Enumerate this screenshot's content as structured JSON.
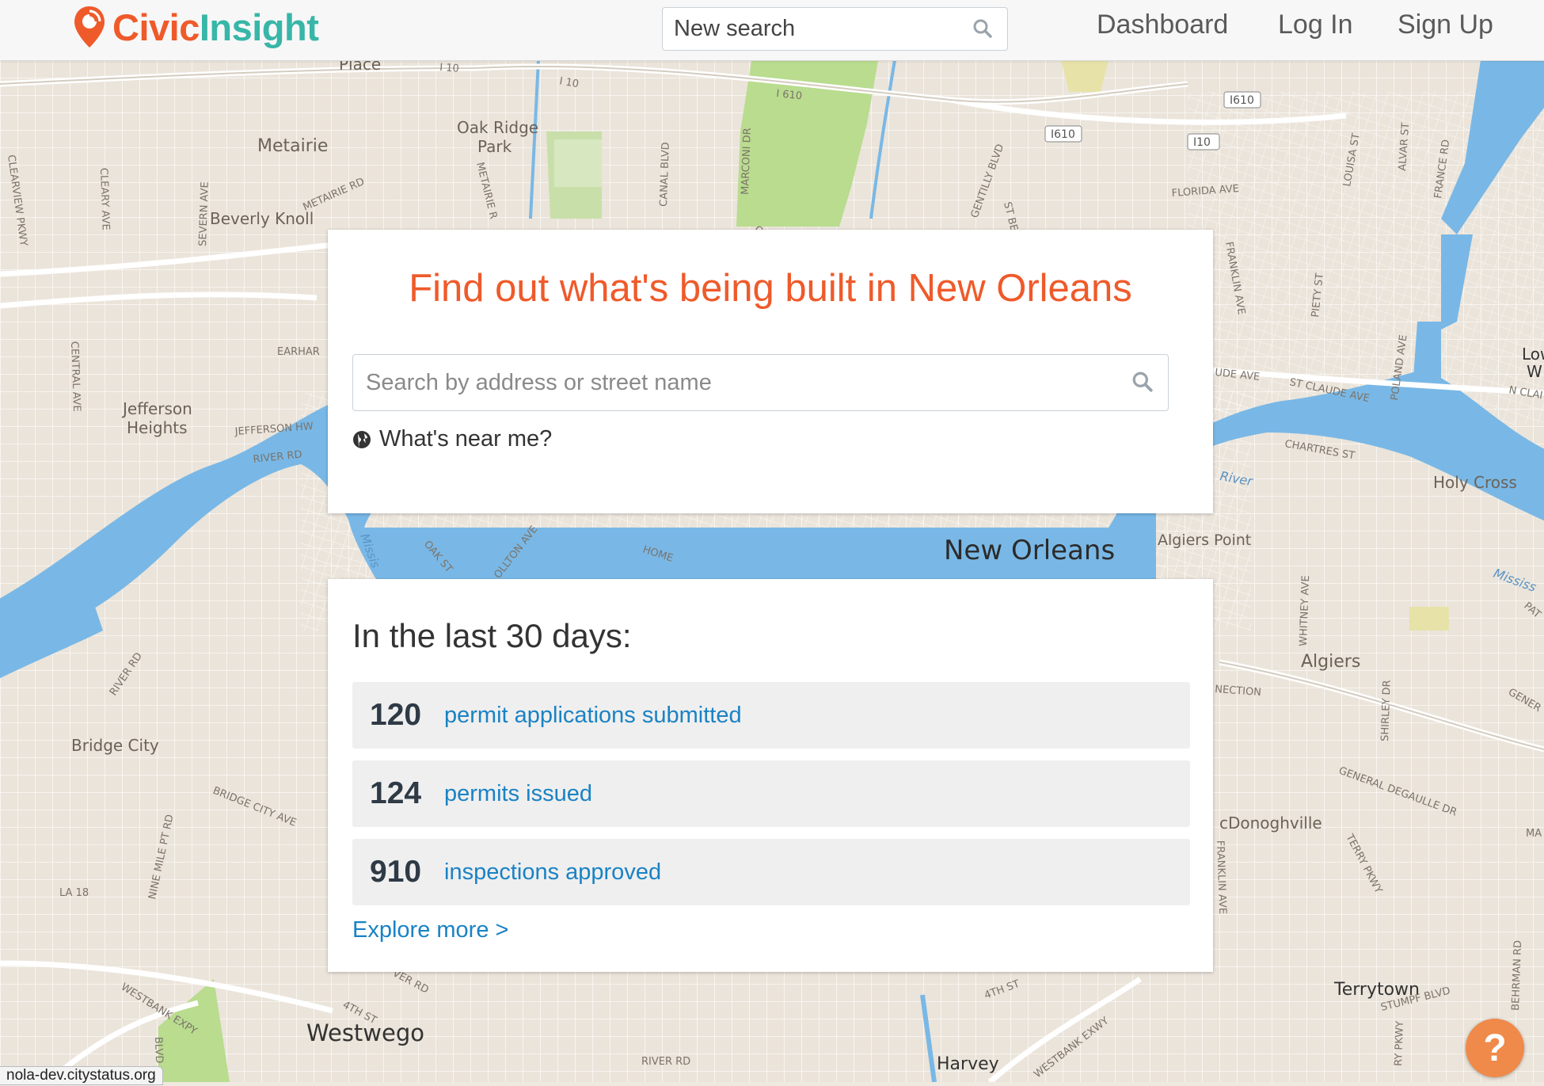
{
  "brand": {
    "civic": "Civic",
    "insight": "Insight"
  },
  "header": {
    "search_placeholder": "New search",
    "nav": [
      "Dashboard",
      "Log In",
      "Sign Up"
    ]
  },
  "hero": {
    "title": "Find out what's being built in New Orleans",
    "search_placeholder": "Search by address or street name",
    "near_me": "What's near me?"
  },
  "stats": {
    "heading": "In the last 30 days:",
    "rows": [
      {
        "value": "120",
        "label": "permit applications submitted"
      },
      {
        "value": "124",
        "label": "permits issued"
      },
      {
        "value": "910",
        "label": "inspections approved"
      }
    ],
    "explore": "Explore more >"
  },
  "status_bar": {
    "url": "nola-dev.citystatus.org"
  },
  "help": {
    "glyph": "?"
  },
  "map": {
    "places": {
      "metairie": "Metairie",
      "oak_ridge": "Oak Ridge",
      "park": "Park",
      "beverly_knoll": "Beverly Knoll",
      "jefferson": "Jefferson",
      "heights": "Heights",
      "bridge_city": "Bridge City",
      "new_orleans": "New Orleans",
      "algiers_point": "Algiers Point",
      "algiers": "Algiers",
      "holy_cross": "Holy Cross",
      "lower": "Lowe",
      "lower_w": "W",
      "mcdonoghville": "cDonoghville",
      "terrytown": "Terrytown",
      "westwego": "Westwego",
      "harvey": "Harvey",
      "place": "Place",
      "river": "River",
      "mississ": "Mississ",
      "missis": "Missis"
    },
    "streets": {
      "metairie_rd": "METAIRIE RD",
      "earhart": "EARHAR",
      "jefferson_hwy": "JEFFERSON HW",
      "river_rd": "RIVER RD",
      "river_rd2": "RIVER RD",
      "bridge_city_ave": "BRIDGE CITY AVE",
      "nine_mile": "NINE MILE PT RD",
      "la18": "LA 18",
      "westbank_expy": "WESTBANK EXPY",
      "central_ave": "CENTRAL AVE",
      "clearview": "CLEARVIEW PKWY",
      "cleary": "CLEARY AVE",
      "severn": "SEVERN AVE",
      "canal_blvd": "CANAL BLVD",
      "marconi": "MARCONI DR",
      "gentilly": "GENTILLY BLVD",
      "florida_ave": "FLORIDA AVE",
      "franklin_ave": "FRANKLIN AVE",
      "piety": "PIETY ST",
      "louisa": "LOUISA ST",
      "alvar": "ALVAR ST",
      "france": "FRANCE RD",
      "st_claude": "ST CLAUDE AVE",
      "chartres": "CHARTRES ST",
      "poland": "POLAND AVE",
      "n_clai": "N CLAI",
      "oak_st": "OAK ST",
      "carrollton": "OLLTON AVE",
      "home": "HOME",
      "whitney": "WHITNEY AVE",
      "shirley": "SHIRLEY DR",
      "general_degaulle": "GENERAL DEGAULLE DR",
      "terry_pkwy": "TERRY PKWY",
      "franklin_ave2": "FRANKLIN AVE",
      "stumpf": "STUMPF BLVD",
      "behrman": "BEHRMAN RD",
      "4th_st": "4TH ST",
      "4th_st2": "4TH ST",
      "westbank_exwy": "WESTBANK EXWY",
      "ver_rd": "VER RD",
      "river_rd3": "RIVER RD",
      "nection": "NECTION",
      "gener": "GENER",
      "ude_ave": "UDE AVE",
      "st_bern": "ST BER",
      "blvd": "BLVD",
      "metairie_r": "METAIRIE R",
      "i10": "I 10",
      "i10b": "I 10",
      "i610": "I 610",
      "ma": "MA",
      "ry_pkwy": "RY PKWY",
      "pat": "PAT",
      "or": "OR"
    },
    "shields": [
      "I610",
      "I610",
      "I10"
    ]
  }
}
